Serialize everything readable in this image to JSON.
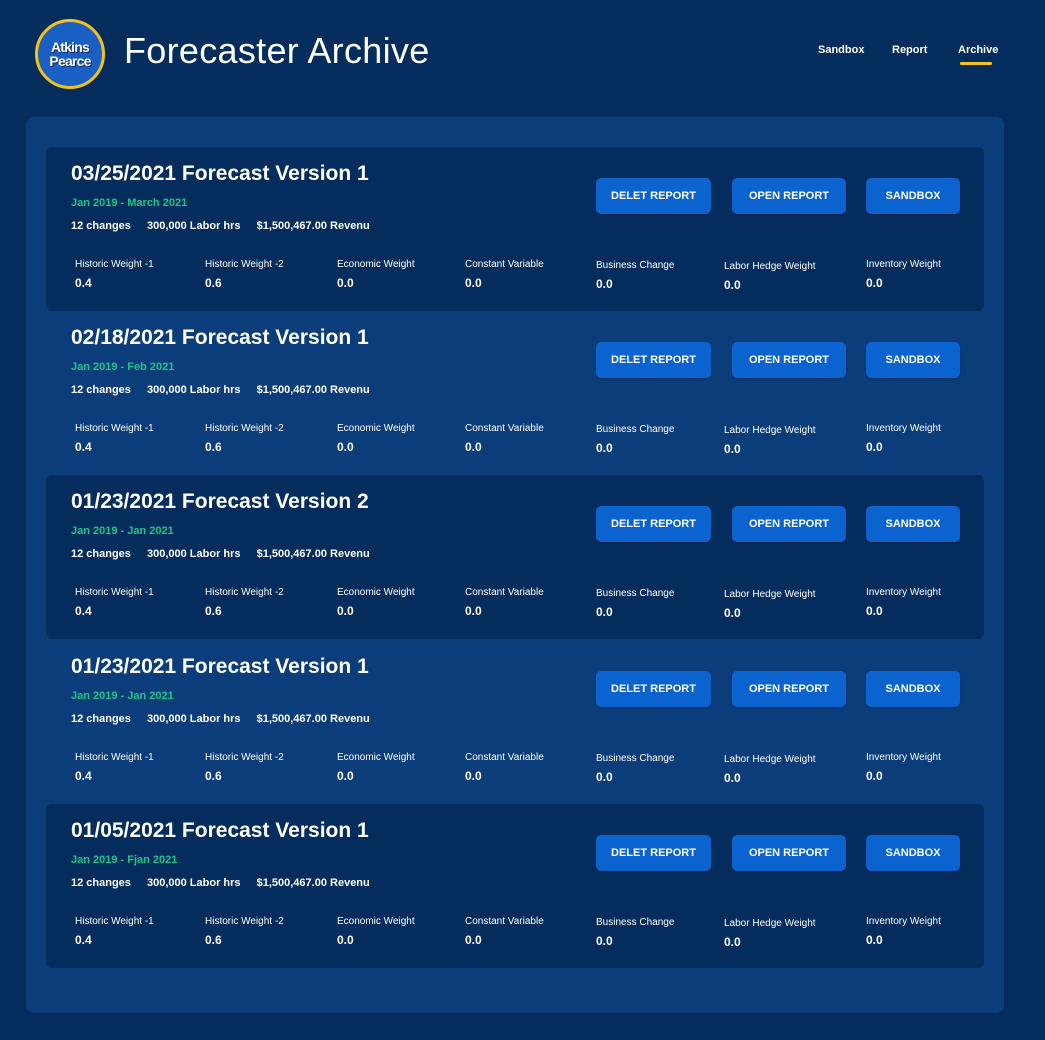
{
  "header": {
    "logo_line1": "Atkins",
    "logo_amp": "&",
    "logo_line2": "Pearce",
    "title": "Forecaster Archive",
    "nav": [
      {
        "label": "Sandbox",
        "active": false
      },
      {
        "label": "Report",
        "active": false
      },
      {
        "label": "Archive",
        "active": true
      }
    ]
  },
  "colors": {
    "background": "#042c5c",
    "panel": "#0a3d7a",
    "accent_yellow": "#f2c21b",
    "date_range_green": "#20c48a",
    "button_blue": "#0a63cf"
  },
  "actions": {
    "delete_label": "DELET REPORT",
    "open_label": "OPEN REPORT",
    "sandbox_label": "SANDBOX"
  },
  "metric_labels": [
    "Historic Weight -1",
    "Historic Weight -2",
    "Economic Weight",
    "Constant Variable",
    "Business Change",
    "Labor Hedge Weight",
    "Inventory Weight"
  ],
  "forecasts": [
    {
      "title": "03/25/2021 Forecast Version 1",
      "range": "Jan  2019 - March 2021",
      "changes": "12 changes",
      "labor": "300,000 Labor hrs",
      "revenue": "$1,500,467.00 Revenu",
      "values": [
        "0.4",
        "0.6",
        "0.0",
        "0.0",
        "0.0",
        "0.0",
        "0.0"
      ]
    },
    {
      "title": "02/18/2021 Forecast Version 1",
      "range": "Jan  2019 - Feb 2021",
      "changes": "12 changes",
      "labor": "300,000 Labor hrs",
      "revenue": "$1,500,467.00 Revenu",
      "values": [
        "0.4",
        "0.6",
        "0.0",
        "0.0",
        "0.0",
        "0.0",
        "0.0"
      ]
    },
    {
      "title": "01/23/2021 Forecast Version 2",
      "range": "Jan  2019 - Jan 2021",
      "changes": "12 changes",
      "labor": "300,000 Labor hrs",
      "revenue": "$1,500,467.00 Revenu",
      "values": [
        "0.4",
        "0.6",
        "0.0",
        "0.0",
        "0.0",
        "0.0",
        "0.0"
      ]
    },
    {
      "title": "01/23/2021 Forecast Version 1",
      "range": "Jan  2019 - Jan 2021",
      "changes": "12 changes",
      "labor": "300,000 Labor hrs",
      "revenue": "$1,500,467.00 Revenu",
      "values": [
        "0.4",
        "0.6",
        "0.0",
        "0.0",
        "0.0",
        "0.0",
        "0.0"
      ]
    },
    {
      "title": "01/05/2021 Forecast Version 1",
      "range": "Jan  2019 - Fjan 2021",
      "changes": "12 changes",
      "labor": "300,000 Labor hrs",
      "revenue": "$1,500,467.00 Revenu",
      "values": [
        "0.4",
        "0.6",
        "0.0",
        "0.0",
        "0.0",
        "0.0",
        "0.0"
      ]
    }
  ]
}
